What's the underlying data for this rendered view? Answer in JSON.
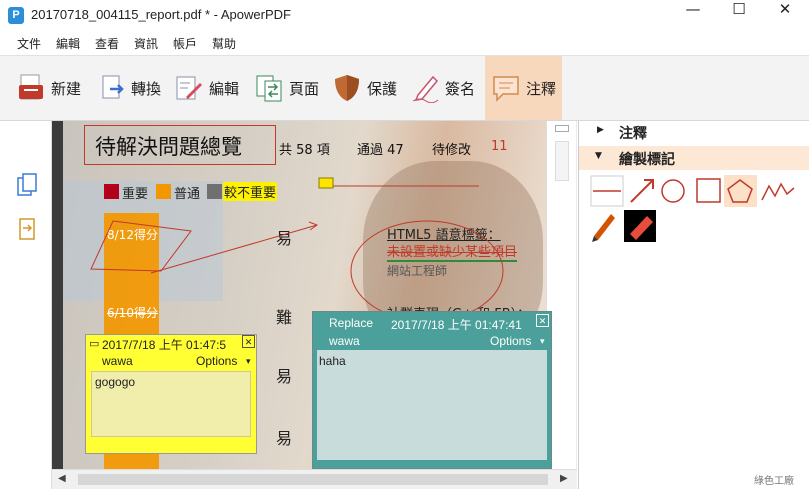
{
  "window": {
    "title": "20170718_004115_report.pdf * - ApowerPDF",
    "app_icon_letter": "P",
    "minimize": "—",
    "maximize": "☐",
    "close": "✕"
  },
  "menu": [
    "文件",
    "編輯",
    "查看",
    "資訊",
    "帳戶",
    "幫助"
  ],
  "toolbar": {
    "items": [
      {
        "label": "新建",
        "icon": "new-pdf-icon"
      },
      {
        "label": "轉換",
        "icon": "convert-icon"
      },
      {
        "label": "編輯",
        "icon": "edit-icon"
      },
      {
        "label": "頁面",
        "icon": "pages-icon"
      },
      {
        "label": "保護",
        "icon": "shield-icon"
      },
      {
        "label": "簽名",
        "icon": "signature-icon"
      },
      {
        "label": "注釋",
        "icon": "comment-icon",
        "active": true
      }
    ],
    "active_color": "#f8d8bd"
  },
  "right_panel": {
    "sections": [
      {
        "label": "注釋",
        "expanded": false
      },
      {
        "label": "繪製標記",
        "expanded": true
      }
    ],
    "tools": [
      "line-tool-icon",
      "arrow-tool-icon",
      "circle-tool-icon",
      "rectangle-tool-icon",
      "pentagon-tool-icon",
      "zigzag-tool-icon",
      "pencil-tool-icon",
      "eraser-tool-icon"
    ]
  },
  "document": {
    "title": "待解決問題總覽",
    "total": "共 58 項",
    "passed": "通過 47",
    "pending_label": "待修改",
    "pending_count": "11",
    "legend": [
      {
        "label": "重要",
        "color": "#b3001b"
      },
      {
        "label": "普通",
        "color": "#f39700"
      },
      {
        "label": "較不重要",
        "color": "#707070"
      }
    ],
    "scores": [
      "8/12得分",
      "6/10得分"
    ],
    "difficulty": [
      "易",
      "難",
      "易",
      "易"
    ],
    "item_title": "HTML5 語意標籤：",
    "item_desc": "未設置或缺少某些項目",
    "item_role": "網站工程師",
    "item2_title": "社群表現（G+ 和 FB）："
  },
  "notes": {
    "yellow": {
      "timestamp": "2017/7/18 上午 01:47:5",
      "author": "wawa",
      "options": "Options",
      "body": "gogogo",
      "close": "✕"
    },
    "teal": {
      "type": "Replace",
      "timestamp": "2017/7/18 上午 01:47:41",
      "author": "wawa",
      "options": "Options",
      "body": "haha",
      "close": "✕"
    }
  },
  "watermark": "綠色工廠"
}
